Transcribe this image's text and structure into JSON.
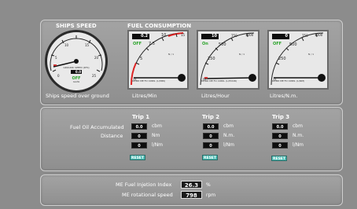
{
  "speed": {
    "title": "SHIPS SPEED",
    "value": "0.0",
    "status": "OFF",
    "ticks": [
      "0",
      "5",
      "10",
      "15",
      "20",
      "25"
    ],
    "inner_label": "GROUND SPEED (KTS)",
    "sub_label": "GLASS",
    "caption": "Ships speed over ground"
  },
  "fuel": {
    "title": "FUEL CONSUMPTION",
    "gauges": [
      {
        "readout": "0.2",
        "unit": "l/min",
        "status": "OFF",
        "ticks": [
          "0",
          "2.5",
          "5",
          "7.5",
          "10",
          "15"
        ],
        "small_ticks": [
          "0",
          "5"
        ],
        "scale_note": "N / 1",
        "footer": "DL-BD\nME FO CONS. (L/MIN)",
        "caption": "Litres/Min"
      },
      {
        "readout": "10",
        "unit": "l/h",
        "status": "On",
        "ticks": [
          "0",
          "250",
          "500",
          "750",
          "1000"
        ],
        "small_ticks": [
          "0",
          "5"
        ],
        "scale_note": "N / 1",
        "footer": "DL-BD\nME FO CONS. (L/HOUR)",
        "caption": "Litres/Hour"
      },
      {
        "readout": "0",
        "unit": "l/nm",
        "status": "OFF",
        "ticks": [
          "0",
          "250",
          "500",
          "750",
          "1000"
        ],
        "small_ticks": [
          "0",
          "5"
        ],
        "scale_note": "N / 1",
        "footer": "DL-BD\nME FO CONS. (L/NM)",
        "caption": "Litres/N.m."
      }
    ]
  },
  "trips": {
    "row_labels": [
      "Fuel Oil Accumulated",
      "Distance"
    ],
    "items": [
      {
        "title": "Trip 1",
        "values": [
          "0.0",
          "0",
          "0"
        ],
        "units": [
          "cbm",
          "Nm",
          "l/Nm"
        ],
        "reset": "RESET"
      },
      {
        "title": "Trip 2",
        "values": [
          "0.0",
          "0",
          "0"
        ],
        "units": [
          "cbm",
          "N.m.",
          "l/Nm"
        ],
        "reset": "RESET"
      },
      {
        "title": "Trip 3",
        "values": [
          "0.0",
          "0",
          "0"
        ],
        "units": [
          "cbm",
          "N.m.",
          "l/Nm"
        ],
        "reset": "RESET"
      }
    ]
  },
  "engine": {
    "fuel_index_label": "ME Fuel Injetion Index",
    "fuel_index_value": "26.3",
    "fuel_index_unit": "%",
    "rpm_label": "ME rotational speed",
    "rpm_value": "798",
    "rpm_unit": "rpm"
  },
  "colors": {
    "panel": "#999999",
    "accent_green": "#6fd36f",
    "reset_button": "#4cbcb4",
    "needle": "#111111"
  }
}
